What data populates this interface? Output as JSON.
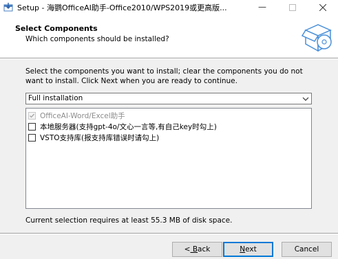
{
  "window": {
    "title": "Setup - 海鹦OfficeAI助手-Office2010/WPS2019或更高版..."
  },
  "header": {
    "title": "Select Components",
    "subtitle": "Which components should be installed?"
  },
  "instructions": "Select the components you want to install; clear the components you do not want to install. Click Next when you are ready to continue.",
  "install_type": {
    "selected": "Full installation"
  },
  "components": [
    {
      "label": "OfficeAI-Word/Excel助手",
      "checked": true,
      "disabled": true
    },
    {
      "label": "本地服务器(支持gpt-4o/文心一言等,有自己key时勾上)",
      "checked": false,
      "disabled": false
    },
    {
      "label": "VSTO支持库(报支持库错误时请勾上)",
      "checked": false,
      "disabled": false
    }
  ],
  "disk_space": "Current selection requires at least 55.3 MB of disk space.",
  "buttons": {
    "back_prefix": "<",
    "back_key": " B",
    "back_rest": "ack",
    "next_key": "N",
    "next_rest": "ext",
    "cancel": "Cancel"
  }
}
